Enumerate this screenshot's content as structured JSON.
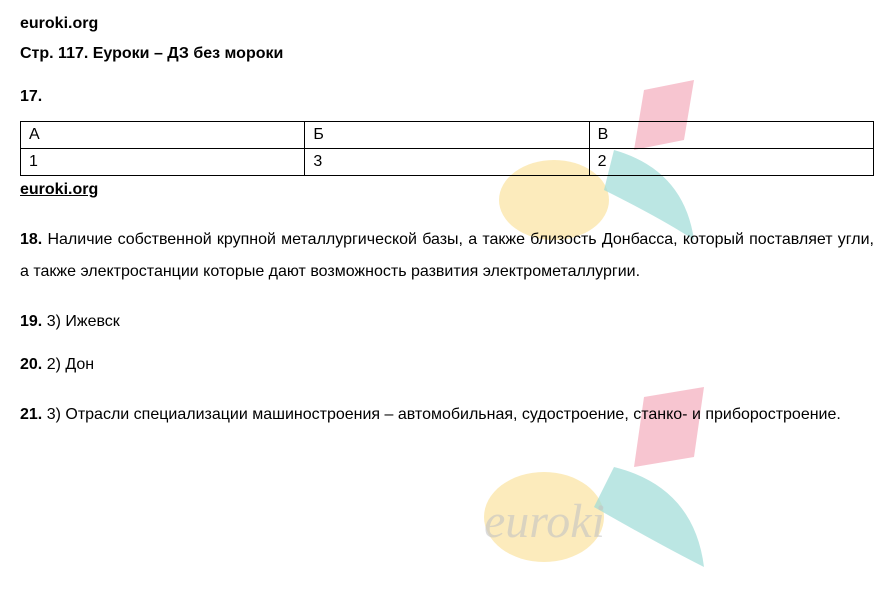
{
  "site_name": "euroki.org",
  "page_title": "Стр. 117. Еуроки – ДЗ без мороки",
  "q17": {
    "num": "17.",
    "headers": [
      "А",
      "Б",
      "В"
    ],
    "values": [
      "1",
      "3",
      "2"
    ]
  },
  "site_name_mid": "euroki.org",
  "q18": {
    "num": "18.",
    "text": "Наличие собственной крупной металлургической базы, а также близость Донбасса, который поставляет угли, а также электростанции которые дают возможность развития электрометаллургии."
  },
  "q19": {
    "num": "19.",
    "text": "3) Ижевск"
  },
  "q20": {
    "num": "20.",
    "text": "2) Дон"
  },
  "q21": {
    "num": "21.",
    "text": "3) Отрасли специализации машиностроения – автомобильная, судостроение, станко- и приборостроение."
  }
}
